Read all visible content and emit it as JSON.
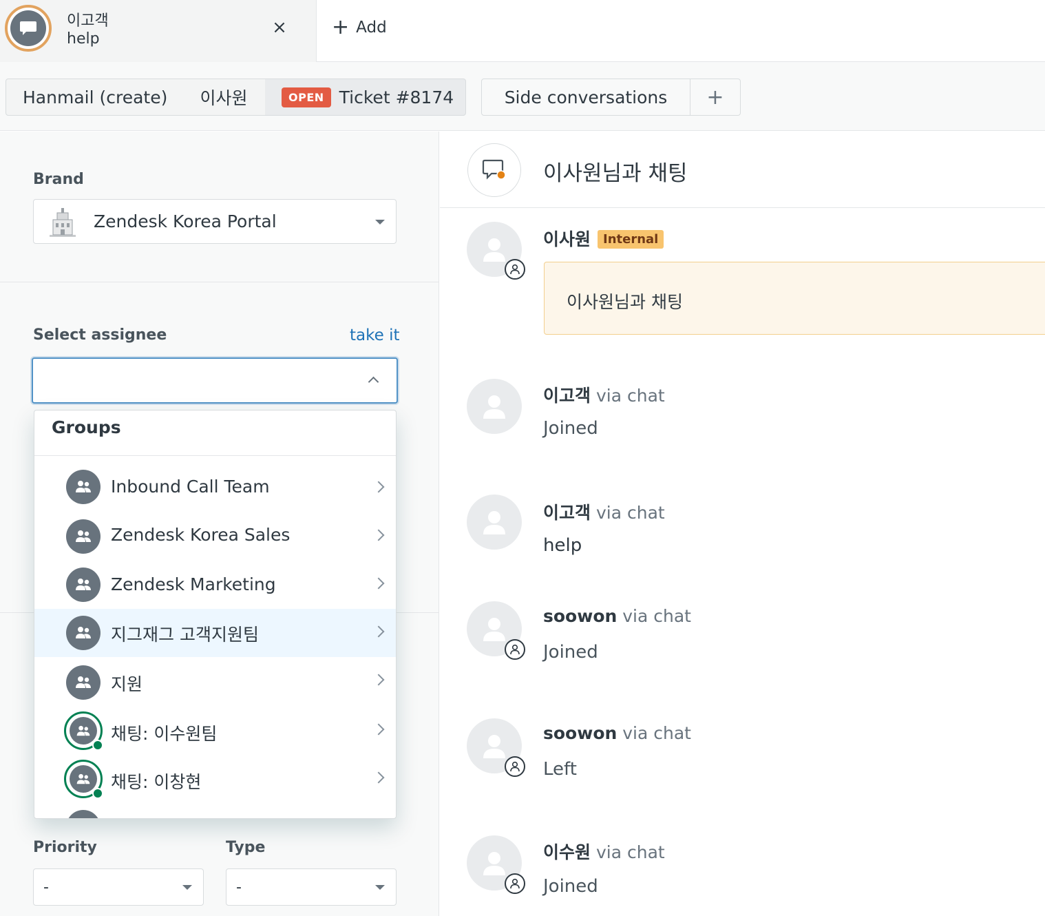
{
  "top_tab": {
    "customer_name": "이고객",
    "subtitle": "help",
    "close_glyph": "×",
    "add_label": "Add",
    "add_glyph": "+"
  },
  "breadcrumbs": {
    "items": [
      "Hanmail (create)",
      "이사원"
    ],
    "ticket_status": "OPEN",
    "ticket_label": "Ticket #8174"
  },
  "side_conversations": {
    "label": "Side conversations",
    "plus_glyph": "+"
  },
  "properties": {
    "brand_label": "Brand",
    "brand_value": "Zendesk Korea Portal",
    "assignee_label": "Select assignee",
    "take_it_label": "take it",
    "assignee_value": "",
    "priority_label": "Priority",
    "priority_value": "-",
    "type_label": "Type",
    "type_value": "-"
  },
  "assignee_dropdown": {
    "header": "Groups",
    "items": [
      {
        "label": "Inbound Call Team",
        "icon": "group-icon",
        "chat": false,
        "highlighted": false
      },
      {
        "label": "Zendesk Korea Sales",
        "icon": "group-icon",
        "chat": false,
        "highlighted": false
      },
      {
        "label": "Zendesk Marketing",
        "icon": "group-icon",
        "chat": false,
        "highlighted": false
      },
      {
        "label": "지그재그 고객지원팀",
        "icon": "group-icon",
        "chat": false,
        "highlighted": true
      },
      {
        "label": "지원",
        "icon": "group-icon",
        "chat": false,
        "highlighted": false
      },
      {
        "label": "채팅: 이수원팀",
        "icon": "group-icon",
        "chat": true,
        "highlighted": false
      },
      {
        "label": "채팅: 이창현",
        "icon": "group-icon",
        "chat": true,
        "highlighted": false
      }
    ]
  },
  "conversation": {
    "title": "이사원님과 채팅",
    "messages": [
      {
        "sender": "이사원",
        "via": "",
        "badge": "Internal",
        "text": "이사원님과 채팅",
        "agent": true,
        "internal": true
      },
      {
        "sender": "이고객",
        "via": "via chat",
        "badge": "",
        "text": "Joined",
        "agent": false,
        "internal": false
      },
      {
        "sender": "이고객",
        "via": "via chat",
        "badge": "",
        "text": "help",
        "agent": false,
        "internal": false
      },
      {
        "sender": "soowon",
        "via": "via chat",
        "badge": "",
        "text": "Joined",
        "agent": true,
        "internal": false
      },
      {
        "sender": "soowon",
        "via": "via chat",
        "badge": "",
        "text": "Left",
        "agent": true,
        "internal": false
      },
      {
        "sender": "이수원",
        "via": "via chat",
        "badge": "",
        "text": "Joined",
        "agent": true,
        "internal": false
      }
    ]
  },
  "colors": {
    "open_badge": "#e35b43",
    "internal_badge": "#f8c46e",
    "link": "#1f73b7",
    "online": "#038153",
    "chat_ring": "#e2a35f"
  }
}
